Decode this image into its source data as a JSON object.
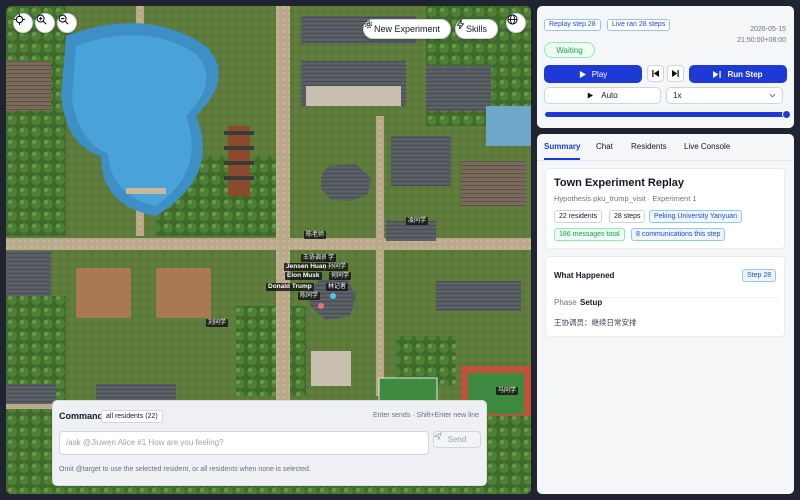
{
  "map": {
    "new_experiment_label": "New Experiment",
    "skills_label": "Skills",
    "labels": {
      "zhao_laoshi": "陈老师",
      "ling_tongxue": "凌同学",
      "wang_tiaoyuan": "王协调员",
      "xue": "学",
      "jensen": "Jensen Huang",
      "jensen_cn": "孙同学",
      "elon": "Elon Musk",
      "elon_cn": "何同学",
      "trump": "Donald Trump",
      "trump_cn": "林记者",
      "chen": "陈同学",
      "liu": "刘同学",
      "ma": "马同学"
    }
  },
  "command": {
    "title": "Command",
    "scope_chip": "all residents (22)",
    "hint": "Enter sends · Shift+Enter new line",
    "placeholder": "/ask @Jiuwen Alice #1 How are you feeling?",
    "send_label": "Send",
    "footer": "Omit @target to use the selected resident, or all residents when none is selected."
  },
  "controls": {
    "replay_step": "Replay step 28",
    "live_ran": "Live ran 28 steps",
    "date": "2026-05-15",
    "time": "21:50:00+08:00",
    "status": "Waiting",
    "play_label": "Play",
    "run_step_label": "Run Step",
    "auto_label": "Auto",
    "speed_value": "1x",
    "progress": 1.0,
    "accent_color": "#1e3ad6"
  },
  "tabs": [
    "Summary",
    "Chat",
    "Residents",
    "Live Console"
  ],
  "summary": {
    "title": "Town Experiment Replay",
    "subtitle": "Hypothesis pku_trump_visit · Experiment 1",
    "residents": "22 residents",
    "steps": "28 steps",
    "location": "Peking University Yanyuan",
    "messages": "186 messages total",
    "communications": "8 communications this step"
  },
  "what_happened": {
    "title": "What Happened",
    "step_badge": "Step 28",
    "phase_label": "Phase",
    "phase_value": "Setup",
    "entry": "王协调员：继续日常安排"
  }
}
